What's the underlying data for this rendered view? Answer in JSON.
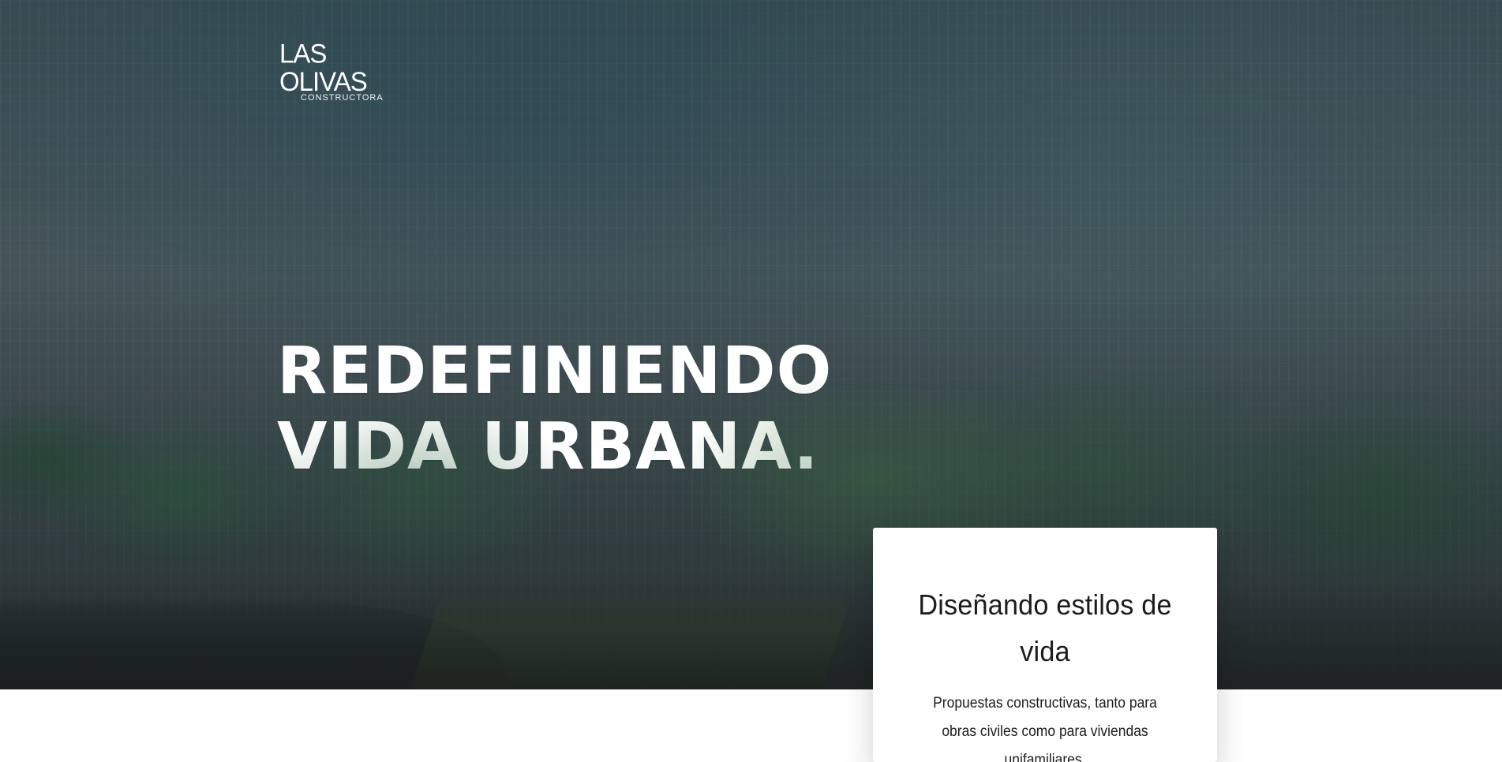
{
  "brand": {
    "name": "LAS OLIVAS",
    "tagline": "CONSTRUCTORA"
  },
  "hero": {
    "headline_line_1": "REDEFINIENDO",
    "headline_line_2": "VIDA URBANA."
  },
  "feature_card": {
    "title": "Diseñando estilos de vida",
    "description": "Propuestas constructivas, tanto para obras civiles como para viviendas unifamiliares."
  },
  "colors": {
    "text_on_image": "#ffffff",
    "card_background": "#ffffff",
    "card_text": "#1c1c1c"
  }
}
